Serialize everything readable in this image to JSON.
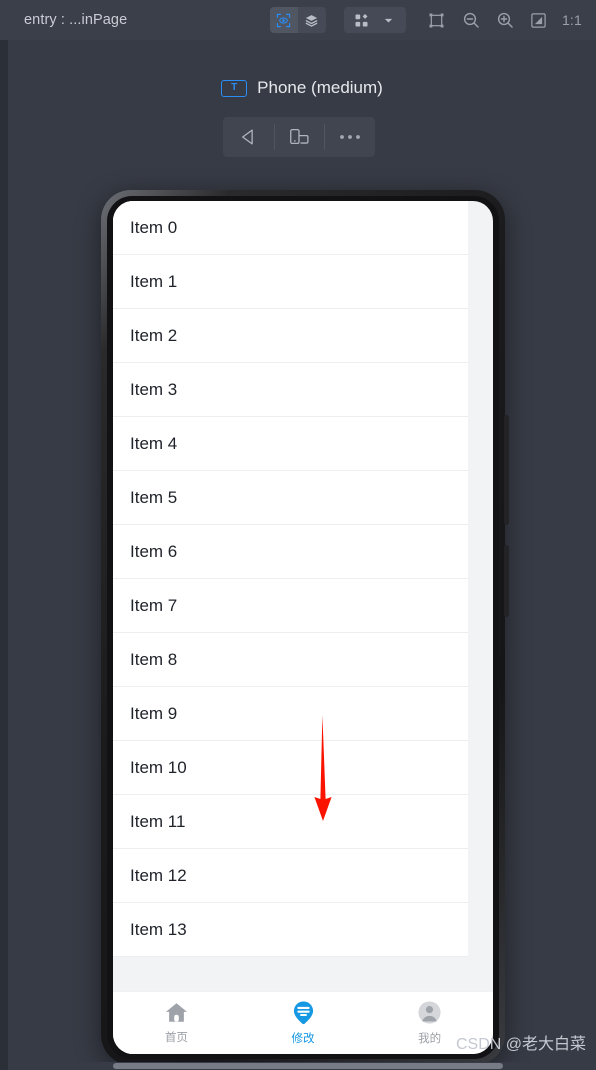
{
  "toolbar": {
    "title": "entry : ...inPage",
    "preview_eye_icon": "eye-preview-icon",
    "layers_icon": "layers-icon",
    "grid_icon": "grid-components-icon",
    "dropdown_icon": "chevron-down-icon",
    "frame_icon": "frame-select-icon",
    "zoom_out_icon": "zoom-out-icon",
    "zoom_in_icon": "zoom-in-icon",
    "fit_screen_icon": "fit-to-screen-icon",
    "zoom_ratio": "1:1"
  },
  "device": {
    "badge": "T",
    "name": "Phone (medium)",
    "actions": [
      {
        "name": "back-arrow-button",
        "icon": "triangle-left-icon"
      },
      {
        "name": "rotate-device-button",
        "icon": "device-rotate-icon"
      },
      {
        "name": "more-options-button",
        "icon": "ellipsis-icon"
      }
    ]
  },
  "preview": {
    "list_items": [
      "Item 0",
      "Item 1",
      "Item 2",
      "Item 3",
      "Item 4",
      "Item 5",
      "Item 6",
      "Item 7",
      "Item 8",
      "Item 9",
      "Item 10",
      "Item 11",
      "Item 12",
      "Item 13"
    ],
    "tabbar": [
      {
        "label": "首页",
        "icon": "home-icon",
        "active": false
      },
      {
        "label": "修改",
        "icon": "edit-pin-icon",
        "active": true
      },
      {
        "label": "我的",
        "icon": "profile-avatar-icon",
        "active": false
      }
    ]
  },
  "annotation": {
    "arrow": "red-down-arrow",
    "color": "#fa1400"
  },
  "watermark": "CSDN @老大白菜",
  "colors": {
    "accent": "#2a8cf5",
    "tab_active": "#1698e3",
    "toolbar_bg": "#3b3f4a",
    "canvas_bg": "#373b45"
  }
}
